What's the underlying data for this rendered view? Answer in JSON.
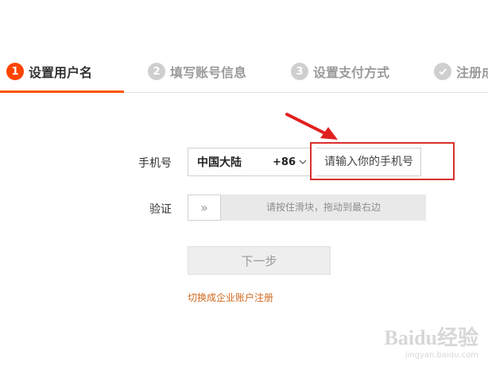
{
  "steps": [
    {
      "num": "1",
      "label": "设置用户名",
      "active": true
    },
    {
      "num": "2",
      "label": "填写账号信息",
      "active": false
    },
    {
      "num": "3",
      "label": "设置支付方式",
      "active": false
    },
    {
      "num": "",
      "label": "注册成",
      "active": false
    }
  ],
  "form": {
    "phone_label": "手机号",
    "region": "中国大陆",
    "country_code": "+86",
    "phone_placeholder": "请输入你的手机号码",
    "verify_label": "验证",
    "slider_text": "请按住滑块，拖动到最右边",
    "slider_handle": "»",
    "next_button": "下一步",
    "switch_link": "切换成企业账户注册"
  },
  "watermark": {
    "brand": "Baidu经验",
    "site": "jingyan.baidu.com"
  },
  "colors": {
    "accent": "#ff5500",
    "highlight": "#d9302c",
    "link": "#d2691e"
  }
}
